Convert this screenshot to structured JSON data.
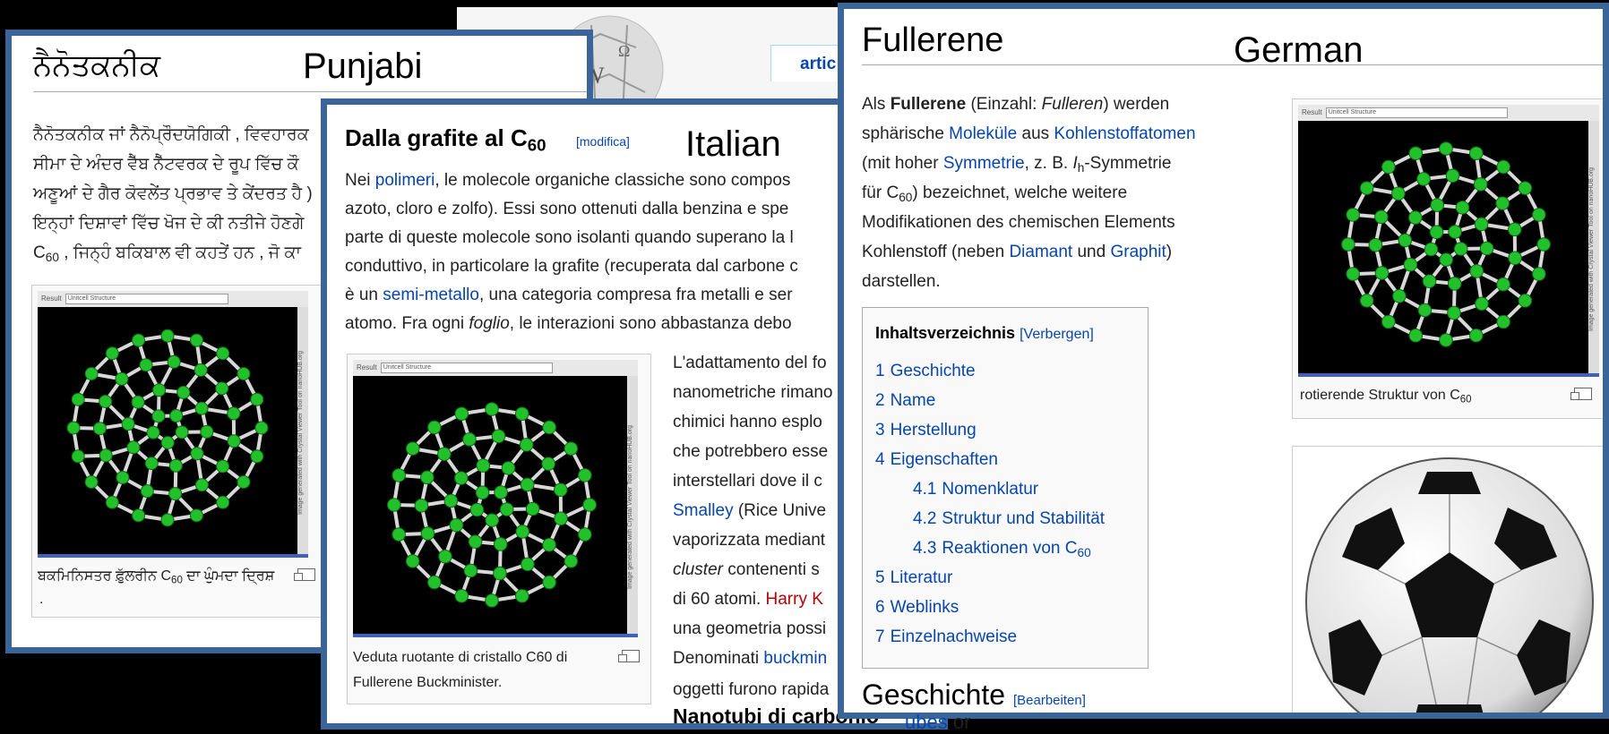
{
  "background_page": {
    "tab_partial": "artic"
  },
  "punjabi": {
    "label": "Punjabi",
    "heading": "ਨੈਨੋਤਕਨੀਕ",
    "lines": [
      "ਨੈਨੋਤਕਨੀਕ ਜਾਂ ਨੈਨੋਪ੍ਰੌਦਯੋਗਿਕੀ , ਵਿਵਹਾਰਕ",
      "ਸੀਮਾ ਦੇ ਅੰਦਰ ਵੈੱਬ ਨੈੱਟਵਰਕ ਦੇ ਰੂਪ ਵਿੱਚ ਕੌ",
      "ਅਣੂਆਂ ਦੇ ਗੈਰ ਕੋਵਲੇਂਤ ਪ੍ਰਭਾਵ ਤੇ ਕੇਂਦਰਤ ਹੈ )",
      "ਇਨ੍ਹਾਂ ਦਿਸ਼ਾਵਾਂ ਵਿੱਚ ਖੋਜ ਦੇ ਕੀ ਨਤੀਜੇ ਹੋਣਗੇ"
    ],
    "line5_pre": "C",
    "line5_sub": "60",
    "line5_post": " , ਜਿਨ੍ਹੰ ਬਕਿਬਾਲ ਵੀ ਕਹਤੇਂ ਹਨ , ਜੋ ਕਾ",
    "viewer_result": "Result",
    "viewer_select": "Unitcell Structure",
    "viewer_side": "Image generated with Crystal Viewer Tool on nanoHUB.org",
    "caption_pre": "ਬਕਮਿਨਿਸਤਰ ਫ਼ੁੱਲਰੀਨ C",
    "caption_sub": "60",
    "caption_post": " ਦਾ ਘੁੰਮਦਾ ਦ੍ਰਿਸ਼",
    "caption_dot": "."
  },
  "italian": {
    "label": "Italian",
    "heading_pre": "Dalla grafite al C",
    "heading_sub": "60",
    "edit": "[modifica]",
    "p1": {
      "l1_a": "Nei ",
      "l1_link": "polimeri",
      "l1_b": ", le molecole organiche classiche sono compos",
      "l2": "azoto, cloro e zolfo). Essi sono ottenuti dalla benzina e spe",
      "l3": "parte di queste molecole sono isolanti quando superano la l",
      "l4": "conduttivo, in particolare la grafite (recuperata dal carbone c",
      "l5_a": "è un ",
      "l5_link": "semi-metallo",
      "l5_b": ", una categoria compresa fra metalli e ser",
      "l6_a": "atomo. Fra ogni ",
      "l6_i": "foglio",
      "l6_b": ", le interazioni sono abbastanza debo"
    },
    "p2": {
      "l1": "L'adattamento del fo",
      "l2": "nanometriche rimano",
      "l3": "chimici hanno esplo",
      "l4": "che potrebbero esse",
      "l5": "interstellari dove il c",
      "l6_link": "Smalley",
      "l6_b": " (Rice Unive",
      "l7": "vaporizzata mediant",
      "l8_i": "cluster",
      "l8_b": " contenenti s",
      "l9_a": "di 60 atomi. ",
      "l9_red": "Harry K",
      "l10": "una geometria possi",
      "l11_a": "Denominati ",
      "l11_link": "buckmin",
      "l12": "oggetti furono rapida"
    },
    "caption_l1": "Veduta ruotante di cristallo C60 di",
    "caption_l2": "Fullerene Buckminister.",
    "subheading": "Nanotubi di carbonio",
    "viewer_result": "Result",
    "viewer_select": "Unitcell Structure",
    "viewer_side": "Image generated with Crystal Viewer Tool on nanoHUB.org"
  },
  "german": {
    "label": "German",
    "heading": "Fullerene",
    "intro": {
      "l1_a": "Als ",
      "l1_b": "Fullerene",
      "l1_c": " (Einzahl: ",
      "l1_i": "Fulleren",
      "l1_d": ") werden",
      "l2_a": "sphärische ",
      "l2_link1": "Moleküle",
      "l2_b": " aus ",
      "l2_link2": "Kohlenstoffatomen",
      "l3_a": "(mit hoher ",
      "l3_link": "Symmetrie",
      "l3_b": ", z. B. ",
      "l3_i": "I",
      "l3_sub": "h",
      "l3_c": "-Symmetrie",
      "l4_a": "für C",
      "l4_sub": "60",
      "l4_b": ") bezeichnet, welche weitere",
      "l5": "Modifikationen des chemischen Elements",
      "l6_a": "Kohlenstoff (neben ",
      "l6_link1": "Diamant",
      "l6_b": " und ",
      "l6_link2": "Graphit",
      "l6_c": ")",
      "l7": "darstellen."
    },
    "toc": {
      "title": "Inhaltsverzeichnis",
      "toggle": "[Verbergen]",
      "items": [
        {
          "num": "1",
          "label": "Geschichte"
        },
        {
          "num": "2",
          "label": "Name"
        },
        {
          "num": "3",
          "label": "Herstellung"
        },
        {
          "num": "4",
          "label": "Eigenschaften"
        },
        {
          "num": "4.1",
          "label": "Nomenklatur"
        },
        {
          "num": "4.2",
          "label": "Struktur und Stabilität"
        },
        {
          "num": "4.3",
          "label": "Reaktionen von C",
          "sub": "60"
        },
        {
          "num": "5",
          "label": "Literatur"
        },
        {
          "num": "6",
          "label": "Weblinks"
        },
        {
          "num": "7",
          "label": "Einzelnachweise"
        }
      ]
    },
    "caption_pre": "rotierende Struktur von C",
    "caption_sub": "60",
    "subheading": "Geschichte",
    "subheading_edit": "[Bearbeiten]",
    "overflow_text_link": "ubes",
    "overflow_text": " or",
    "viewer_result": "Result",
    "viewer_select": "Unitcell Structure",
    "viewer_side": "Image generated with Crystal Viewer Tool on nanoHUB.org"
  }
}
